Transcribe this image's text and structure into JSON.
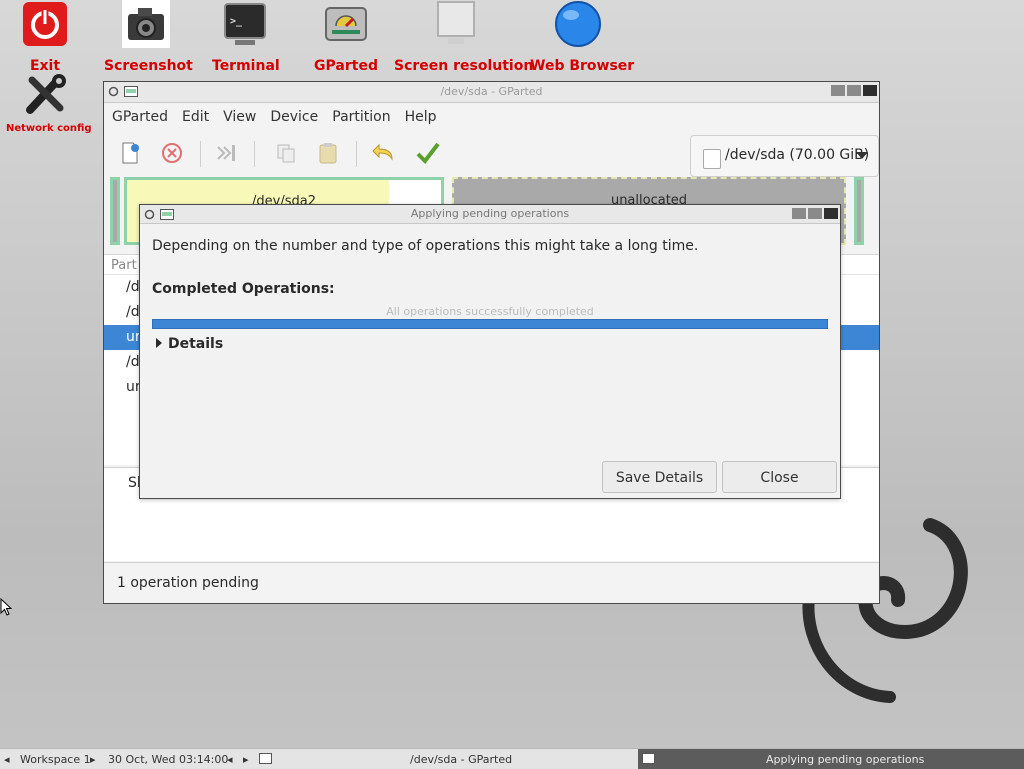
{
  "desktop": {
    "icons": [
      {
        "label": "Exit"
      },
      {
        "label": "Screenshot"
      },
      {
        "label": "Terminal"
      },
      {
        "label": "GParted"
      },
      {
        "label": "Screen resolution"
      },
      {
        "label": "Web Browser"
      },
      {
        "label": "Network config"
      }
    ]
  },
  "window": {
    "title": "/dev/sda - GParted",
    "menu": [
      "GParted",
      "Edit",
      "View",
      "Device",
      "Partition",
      "Help"
    ],
    "device_selector": "/dev/sda (70.00 GiB)",
    "partition_map": {
      "sda2_label": "/dev/sda2",
      "unallocated_label": "unallocated"
    },
    "list_header": "Part",
    "rows": [
      "/d",
      "/d",
      "ur",
      "/d",
      "ur"
    ],
    "details_header": "Sh",
    "status": "1 operation pending"
  },
  "dialog": {
    "title": "Applying pending operations",
    "message": "Depending on the number and type of operations this might take a long time.",
    "completed_label": "Completed Operations:",
    "progress_text": "All operations successfully completed",
    "progress_fraction": 1.0,
    "details_label": "Details",
    "save_details": "Save Details",
    "close": "Close"
  },
  "taskbar": {
    "workspace": "Workspace 1",
    "datetime": "30 Oct, Wed 03:14:00",
    "task1": "/dev/sda - GParted",
    "task2": "Applying pending operations"
  },
  "colors": {
    "accent": "#3d86d6",
    "desktop_label": "#d40000"
  }
}
